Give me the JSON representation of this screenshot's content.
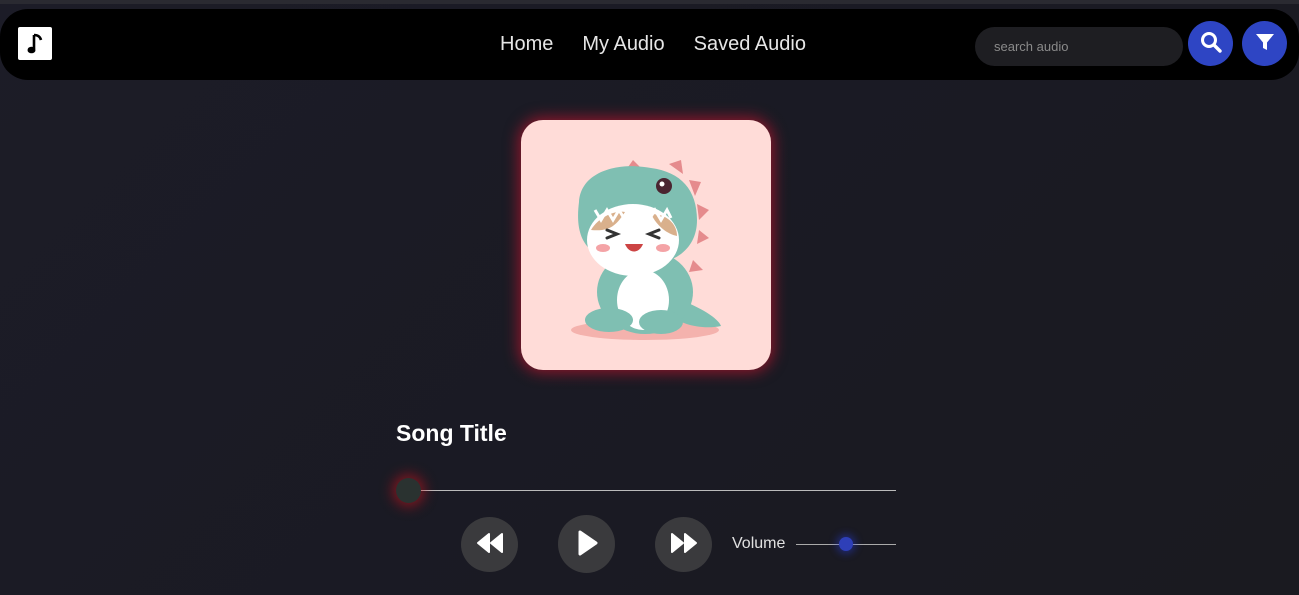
{
  "nav": {
    "links": [
      "Home",
      "My Audio",
      "Saved Audio"
    ],
    "search_placeholder": "search audio",
    "logo_icon": "music-note-icon",
    "search_icon": "search-icon",
    "filter_icon": "filter-icon",
    "accent": "#2e45c4"
  },
  "player": {
    "song_title": "Song Title",
    "cover_art": "dinosaur-costume-cat-illustration",
    "progress": 0,
    "volume_label": "Volume",
    "volume": 0.5,
    "controls": [
      "rewind-icon",
      "play-icon",
      "fast-forward-icon"
    ]
  }
}
